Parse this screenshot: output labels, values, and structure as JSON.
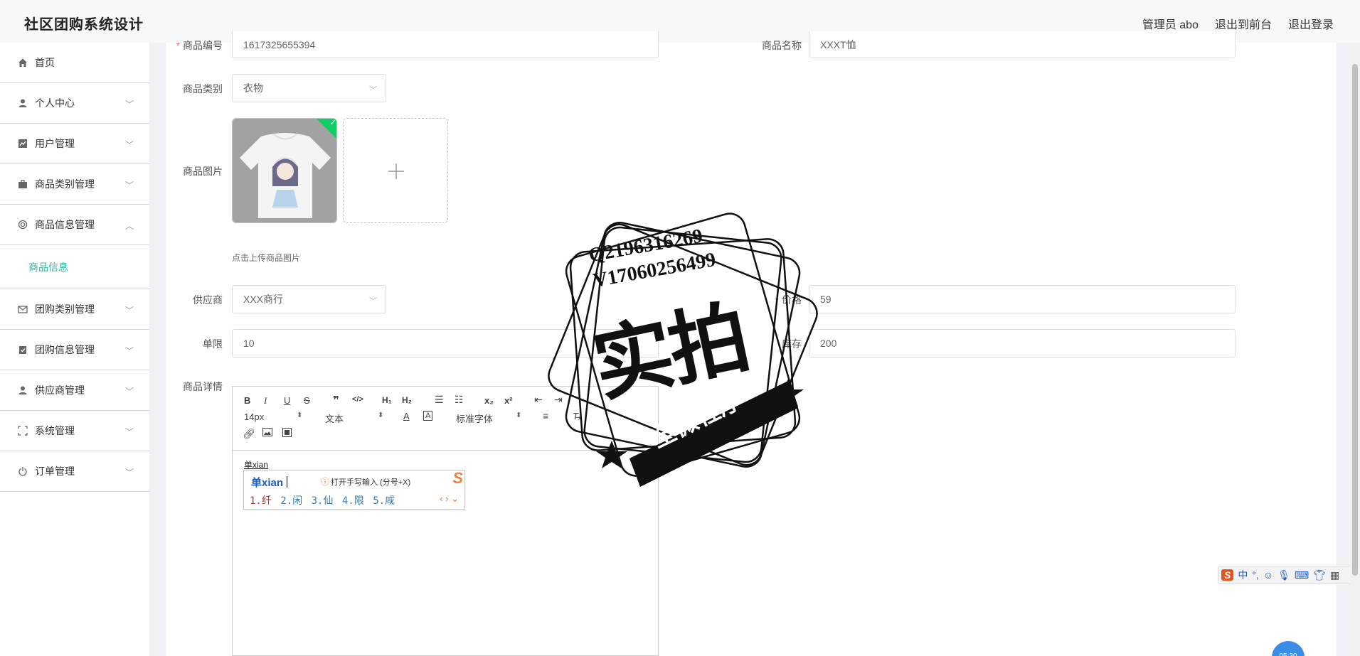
{
  "app": {
    "title": "社区团购系统设计"
  },
  "header": {
    "admin_label": "管理员 abo",
    "front_link": "退出到前台",
    "logout_link": "退出登录"
  },
  "sidebar": {
    "items": [
      {
        "label": "首页",
        "icon": "home-icon"
      },
      {
        "label": "个人中心",
        "icon": "user-icon"
      },
      {
        "label": "用户管理",
        "icon": "chart-icon"
      },
      {
        "label": "商品类别管理",
        "icon": "briefcase-icon"
      },
      {
        "label": "商品信息管理",
        "icon": "settings-icon"
      },
      {
        "label": "团购类别管理",
        "icon": "mail-icon"
      },
      {
        "label": "团购信息管理",
        "icon": "clipboard-icon"
      },
      {
        "label": "供应商管理",
        "icon": "user-icon"
      },
      {
        "label": "系统管理",
        "icon": "frame-icon"
      },
      {
        "label": "订单管理",
        "icon": "power-icon"
      }
    ],
    "active_sub": "商品信息"
  },
  "form": {
    "product_code_label": "商品编号",
    "product_code_value": "1617325655394",
    "product_name_label": "商品名称",
    "product_name_value": "XXXT恤",
    "category_label": "商品类别",
    "category_value": "衣物",
    "image_label": "商品图片",
    "upload_hint": "点击上传商品图片",
    "supplier_label": "供应商",
    "supplier_value": "XXX商行",
    "price_label": "价格",
    "price_value": "59",
    "limit_label": "单限",
    "limit_value": "10",
    "stock_label": "库存",
    "stock_value": "200",
    "detail_label": "商品详情"
  },
  "editor": {
    "font_size": "14px",
    "paragraph": "文本",
    "font_family": "标准字体",
    "content": "单xian"
  },
  "ime": {
    "composition": "单xian",
    "hint": "打开手写输入 (分号+X)",
    "candidates": [
      "1.纤",
      "2.闲",
      "3.仙",
      "4.限",
      "5.咸"
    ]
  },
  "ime_bar": {
    "mode": "中"
  },
  "watermark": {
    "line1": "Q2196316269",
    "line2": "V17060256499",
    "big": "实拍",
    "ribbon": "全微程序"
  },
  "clock": {
    "time": "05:30"
  },
  "colors": {
    "accent": "#2fb89d",
    "required": "#f56c6c",
    "check": "#13ce66"
  }
}
